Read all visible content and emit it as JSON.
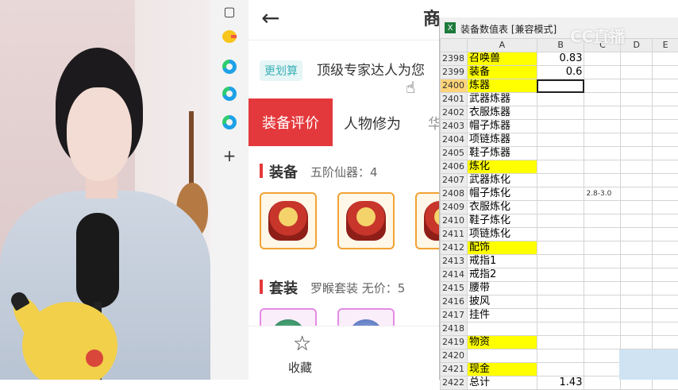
{
  "app": {
    "title_partial": "商",
    "tag": "更划算",
    "tip": "顶级专家达人为您",
    "tabs": [
      "装备评价",
      "人物修为",
      "华"
    ],
    "sections": [
      {
        "title": "装备",
        "subtitle": "五阶仙器：4"
      },
      {
        "title": "套装",
        "subtitle": "罗睺套装  无价：5"
      }
    ],
    "bottom": {
      "fav_label": "收藏"
    }
  },
  "spreadsheet": {
    "window_title": "装备数值表  [兼容模式]",
    "columns": [
      "A",
      "B",
      "C",
      "D",
      "E"
    ],
    "rows": [
      {
        "n": "2398",
        "a": "召唤兽",
        "b": "0.83",
        "c": "",
        "hl": true
      },
      {
        "n": "2399",
        "a": "装备",
        "b": "0.6",
        "c": "",
        "hl": true
      },
      {
        "n": "2400",
        "a": "炼器",
        "b": "",
        "c": "",
        "hl": true,
        "sel": true
      },
      {
        "n": "2401",
        "a": "武器炼器",
        "b": "",
        "c": ""
      },
      {
        "n": "2402",
        "a": "衣服炼器",
        "b": "",
        "c": ""
      },
      {
        "n": "2403",
        "a": "帽子炼器",
        "b": "",
        "c": ""
      },
      {
        "n": "2404",
        "a": "项链炼器",
        "b": "",
        "c": ""
      },
      {
        "n": "2405",
        "a": "鞋子炼器",
        "b": "",
        "c": ""
      },
      {
        "n": "2406",
        "a": "炼化",
        "b": "",
        "c": "",
        "hl": true
      },
      {
        "n": "2407",
        "a": "武器炼化",
        "b": "",
        "c": ""
      },
      {
        "n": "2408",
        "a": "帽子炼化",
        "b": "",
        "c": "2.8-3.0"
      },
      {
        "n": "2409",
        "a": "衣服炼化",
        "b": "",
        "c": ""
      },
      {
        "n": "2410",
        "a": "鞋子炼化",
        "b": "",
        "c": ""
      },
      {
        "n": "2411",
        "a": "项链炼化",
        "b": "",
        "c": ""
      },
      {
        "n": "2412",
        "a": "配饰",
        "b": "",
        "c": "",
        "hl": true
      },
      {
        "n": "2413",
        "a": "戒指1",
        "b": "",
        "c": ""
      },
      {
        "n": "2414",
        "a": "戒指2",
        "b": "",
        "c": ""
      },
      {
        "n": "2415",
        "a": "腰带",
        "b": "",
        "c": ""
      },
      {
        "n": "2416",
        "a": "披风",
        "b": "",
        "c": ""
      },
      {
        "n": "2417",
        "a": "挂件",
        "b": "",
        "c": ""
      },
      {
        "n": "2418",
        "a": "",
        "b": "",
        "c": ""
      },
      {
        "n": "2419",
        "a": "物资",
        "b": "",
        "c": "",
        "hl": true
      },
      {
        "n": "2420",
        "a": "",
        "b": "",
        "c": ""
      },
      {
        "n": "2421",
        "a": "现金",
        "b": "",
        "c": "",
        "hl": true
      },
      {
        "n": "2422",
        "a": "总计",
        "b": "1.43",
        "c": ""
      }
    ]
  },
  "watermark": "CC直播",
  "colors": {
    "accent_red": "#e4393c",
    "highlight_yellow": "#ffff00",
    "tag_teal": "#3ab1b7"
  },
  "icons": [
    "back-arrow-icon",
    "star-icon",
    "excel-icon",
    "edge-icon",
    "plus-icon",
    "sidebar-icon"
  ]
}
